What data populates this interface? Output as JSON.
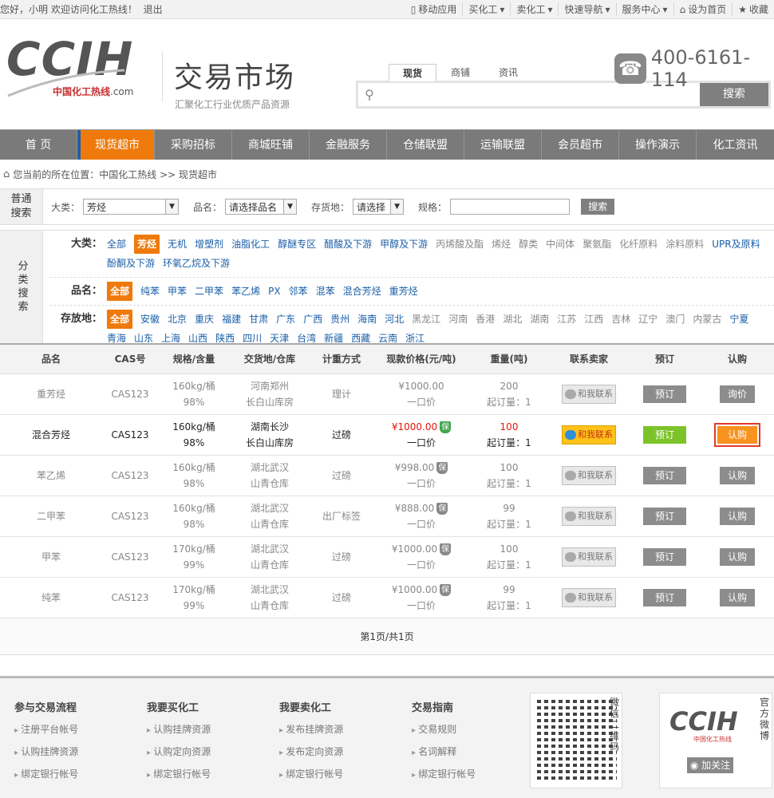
{
  "topbar": {
    "greeting": "您好，小明 欢迎访问化工热线！",
    "logout": "退出",
    "links": [
      "移动应用",
      "买化工",
      "卖化工",
      "快速导航",
      "服务中心",
      "设为首页",
      "收藏"
    ]
  },
  "header": {
    "logo_text": "CCIH",
    "logo_sub": "中国化工热线",
    "logo_dom": ".com",
    "title": "交易市场",
    "subtitle": "汇聚化工行业优质产品资源",
    "search_tabs": [
      "现货",
      "商铺",
      "资讯"
    ],
    "search_button": "搜索",
    "phone": "400-6161-114"
  },
  "nav": [
    "首 页",
    "现货超市",
    "采购招标",
    "商城旺铺",
    "金融服务",
    "仓储联盟",
    "运输联盟",
    "会员超市",
    "操作演示",
    "化工资讯"
  ],
  "breadcrumb": {
    "prefix": "您当前的所在位置：中国化工热线 >> 现货超市"
  },
  "simple_search": {
    "label": "普通搜索",
    "cat_label": "大类：",
    "cat_value": "芳烃",
    "name_label": "品名：",
    "name_value": "请选择品名",
    "loc_label": "存货地：",
    "loc_value": "请选择",
    "spec_label": "规格：",
    "button": "搜索"
  },
  "category_search": {
    "label": "分类搜索",
    "big_label": "大类：",
    "big": [
      "全部",
      "芳烃",
      "无机",
      "增塑剂",
      "油脂化工",
      "醇醚专区",
      "醋酸及下游",
      "甲醇及下游",
      "丙烯酸及酯",
      "烯烃",
      "醇类",
      "中间体",
      "聚氨酯",
      "化纤原料",
      "涂料原料",
      "UPR及原料",
      "酚酮及下游",
      "环氧乙烷及下游"
    ],
    "name_label": "品名：",
    "names": [
      "全部",
      "纯苯",
      "甲苯",
      "二甲苯",
      "苯乙烯",
      "PX",
      "邻苯",
      "混苯",
      "混合芳烃",
      "重芳烃"
    ],
    "loc_label": "存放地：",
    "locs": [
      "全部",
      "安徽",
      "北京",
      "重庆",
      "福建",
      "甘肃",
      "广东",
      "广西",
      "贵州",
      "海南",
      "河北",
      "黑龙江",
      "河南",
      "香港",
      "湖北",
      "湖南",
      "江苏",
      "江西",
      "吉林",
      "辽宁",
      "澳门",
      "内蒙古",
      "宁夏",
      "青海",
      "山东",
      "上海",
      "山西",
      "陕西",
      "四川",
      "天津",
      "台湾",
      "新疆",
      "西藏",
      "云南",
      "浙江"
    ]
  },
  "table": {
    "headers": [
      "品名",
      "CAS号",
      "规格/含量",
      "交货地/仓库",
      "计重方式",
      "现款价格(元/吨)",
      "重量(吨)",
      "联系卖家",
      "预订",
      "认购"
    ],
    "rows": [
      {
        "name": "重芳烃",
        "cas": "CAS123",
        "spec": "160kg/桶",
        "purity": "98%",
        "loc": "河南郑州",
        "wh": "长白山库房",
        "method": "理计",
        "price": "¥1000.00",
        "price_type": "一口价",
        "weight": "200",
        "min": "起订量：1",
        "contact": "和我联系",
        "pre": "预订",
        "buy": "询价"
      },
      {
        "name": "混合芳烃",
        "cas": "CAS123",
        "spec": "160kg/桶",
        "purity": "98%",
        "loc": "湖南长沙",
        "wh": "长白山库房",
        "method": "过磅",
        "price": "¥1000.00",
        "price_type": "一口价",
        "weight": "100",
        "min": "起订量：1",
        "contact": "和我联系",
        "pre": "预订",
        "buy": "认购"
      },
      {
        "name": "苯乙烯",
        "cas": "CAS123",
        "spec": "160kg/桶",
        "purity": "98%",
        "loc": "湖北武汉",
        "wh": "山青仓库",
        "method": "过磅",
        "price": "¥998.00",
        "price_type": "一口价",
        "weight": "100",
        "min": "起订量：1",
        "contact": "和我联系",
        "pre": "预订",
        "buy": "认购"
      },
      {
        "name": "二甲苯",
        "cas": "CAS123",
        "spec": "160kg/桶",
        "purity": "98%",
        "loc": "湖北武汉",
        "wh": "山青仓库",
        "method": "出厂标签",
        "price": "¥888.00",
        "price_type": "一口价",
        "weight": "99",
        "min": "起订量：1",
        "contact": "和我联系",
        "pre": "预订",
        "buy": "认购"
      },
      {
        "name": "甲苯",
        "cas": "CAS123",
        "spec": "170kg/桶",
        "purity": "99%",
        "loc": "湖北武汉",
        "wh": "山青仓库",
        "method": "过磅",
        "price": "¥1000.00",
        "price_type": "一口价",
        "weight": "100",
        "min": "起订量：1",
        "contact": "和我联系",
        "pre": "预订",
        "buy": "认购"
      },
      {
        "name": "纯苯",
        "cas": "CAS123",
        "spec": "170kg/桶",
        "purity": "99%",
        "loc": "湖北武汉",
        "wh": "山青仓库",
        "method": "过磅",
        "price": "¥1000.00",
        "price_type": "一口价",
        "weight": "99",
        "min": "起订量：1",
        "contact": "和我联系",
        "pre": "预订",
        "buy": "认购"
      }
    ],
    "guarantee_mark": "保"
  },
  "pager": "第1页/共1页",
  "footer": {
    "cols": [
      {
        "title": "参与交易流程",
        "links": [
          "注册平台帐号",
          "认购挂牌资源",
          "绑定银行帐号"
        ]
      },
      {
        "title": "我要买化工",
        "links": [
          "认购挂牌资源",
          "认购定向资源",
          "绑定银行帐号"
        ]
      },
      {
        "title": "我要卖化工",
        "links": [
          "发布挂牌资源",
          "发布定向资源",
          "绑定银行帐号"
        ]
      },
      {
        "title": "交易指南",
        "links": [
          "交易规则",
          "名词解释",
          "绑定银行帐号"
        ]
      }
    ],
    "wechat": "微信二维码",
    "weibo": "官方微博",
    "follow": "加关注",
    "qr_logo": "CCIH"
  },
  "colors": {
    "accent": "#ef7a0b",
    "nav_bg": "#7a7a7a",
    "highlight_blue": "#1f5fa8",
    "price_red": "#e3160b",
    "green": "#7cc32a"
  }
}
